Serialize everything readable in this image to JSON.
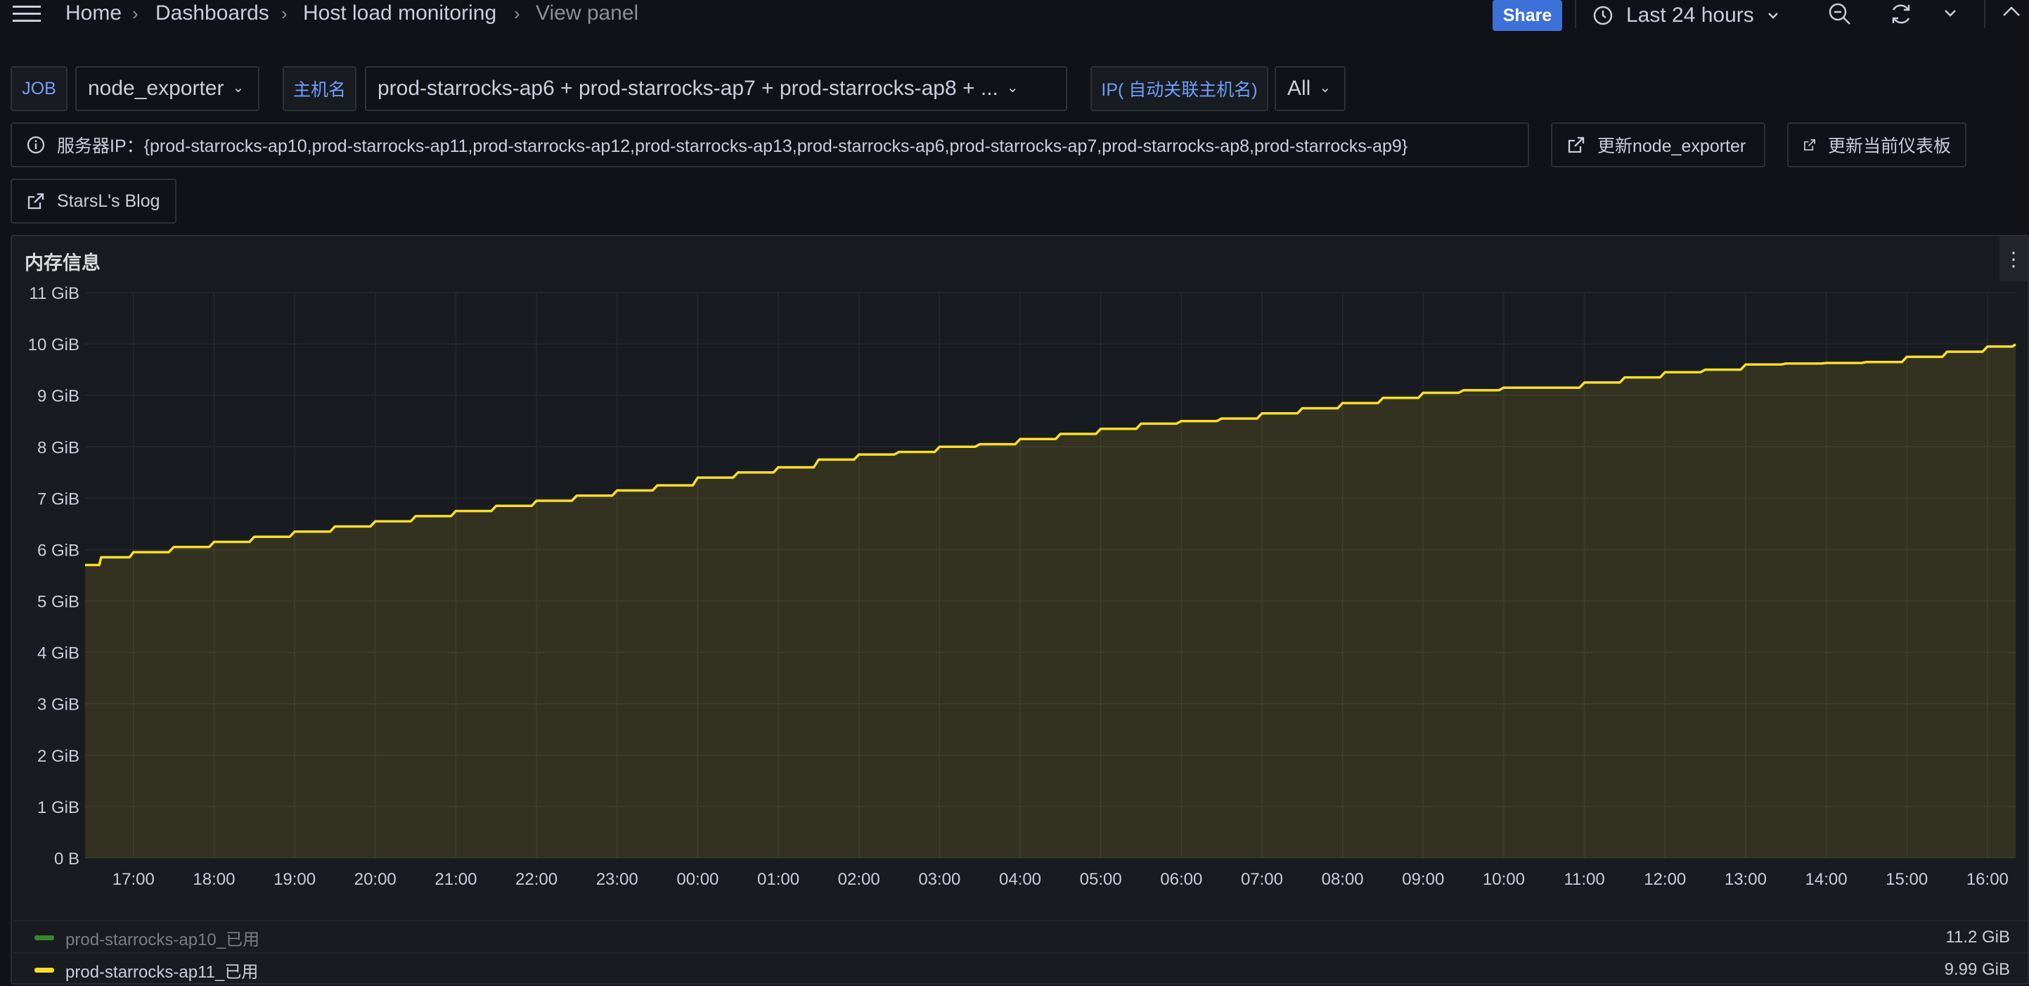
{
  "breadcrumb": {
    "items": [
      "Home",
      "Dashboards",
      "Host load monitoring",
      "View panel"
    ]
  },
  "toolbar": {
    "share_label": "Share",
    "time_range": "Last 24 hours",
    "icons": [
      "menu-icon",
      "clock-icon",
      "zoom-out-icon",
      "refresh-icon",
      "chevron-down-icon",
      "chevron-up-icon"
    ]
  },
  "variables": {
    "job_label": "JOB",
    "job_value": "node_exporter",
    "host_label": "主机名",
    "host_value": "prod-starrocks-ap6 + prod-starrocks-ap7 + prod-starrocks-ap8 + ...",
    "ip_label": "IP( 自动关联主机名)",
    "ip_value": "All"
  },
  "links": {
    "server_ip": "服务器IP：{prod-starrocks-ap10,prod-starrocks-ap11,prod-starrocks-ap12,prod-starrocks-ap13,prod-starrocks-ap6,prod-starrocks-ap7,prod-starrocks-ap8,prod-starrocks-ap9}",
    "update_exporter": "更新node_exporter",
    "update_dashboard": "更新当前仪表板",
    "blog": "StarsL's Blog"
  },
  "panel": {
    "title": "内存信息",
    "legend": [
      {
        "name": "prod-starrocks-ap10_已用",
        "value": "11.2 GiB",
        "color": "#37872d",
        "dim": true
      },
      {
        "name": "prod-starrocks-ap11_已用",
        "value": "9.99 GiB",
        "color": "#fade2a",
        "dim": false
      }
    ]
  },
  "chart_data": {
    "type": "area",
    "title": "内存信息",
    "y_ticks": [
      "0 B",
      "1 GiB",
      "2 GiB",
      "3 GiB",
      "4 GiB",
      "5 GiB",
      "6 GiB",
      "7 GiB",
      "8 GiB",
      "9 GiB",
      "10 GiB",
      "11 GiB"
    ],
    "ylim": [
      0,
      11
    ],
    "y_unit": "GiB",
    "x_ticks": [
      "17:00",
      "18:00",
      "19:00",
      "20:00",
      "21:00",
      "22:00",
      "23:00",
      "00:00",
      "01:00",
      "02:00",
      "03:00",
      "04:00",
      "05:00",
      "06:00",
      "07:00",
      "08:00",
      "09:00",
      "10:00",
      "11:00",
      "12:00",
      "13:00",
      "14:00",
      "15:00",
      "16:00"
    ],
    "x_range_hours": [
      16.4,
      40.35
    ],
    "series": [
      {
        "name": "prod-starrocks-ap11_已用",
        "color": "#fade2a",
        "x_hours": [
          16.4,
          16.6,
          17.0,
          17.5,
          18.0,
          18.5,
          19.0,
          19.5,
          20.0,
          20.5,
          21.0,
          21.5,
          22.0,
          22.5,
          23.0,
          23.5,
          24.0,
          24.5,
          25.0,
          25.5,
          26.0,
          26.5,
          27.0,
          27.5,
          28.0,
          28.5,
          29.0,
          29.5,
          30.0,
          30.5,
          31.0,
          31.5,
          32.0,
          32.5,
          33.0,
          33.5,
          34.0,
          34.5,
          35.0,
          35.5,
          36.0,
          36.5,
          37.0,
          37.5,
          38.0,
          38.5,
          39.0,
          39.5,
          40.0,
          40.35
        ],
        "values": [
          5.7,
          5.85,
          5.95,
          6.05,
          6.15,
          6.25,
          6.35,
          6.45,
          6.55,
          6.65,
          6.75,
          6.85,
          6.95,
          7.05,
          7.15,
          7.25,
          7.4,
          7.5,
          7.6,
          7.75,
          7.85,
          7.9,
          8.0,
          8.05,
          8.15,
          8.25,
          8.35,
          8.45,
          8.5,
          8.55,
          8.65,
          8.75,
          8.85,
          8.95,
          9.05,
          9.1,
          9.15,
          9.15,
          9.25,
          9.35,
          9.45,
          9.5,
          9.6,
          9.62,
          9.63,
          9.65,
          9.75,
          9.85,
          9.95,
          9.99
        ]
      }
    ],
    "grid": true,
    "legend_position": "bottom"
  }
}
